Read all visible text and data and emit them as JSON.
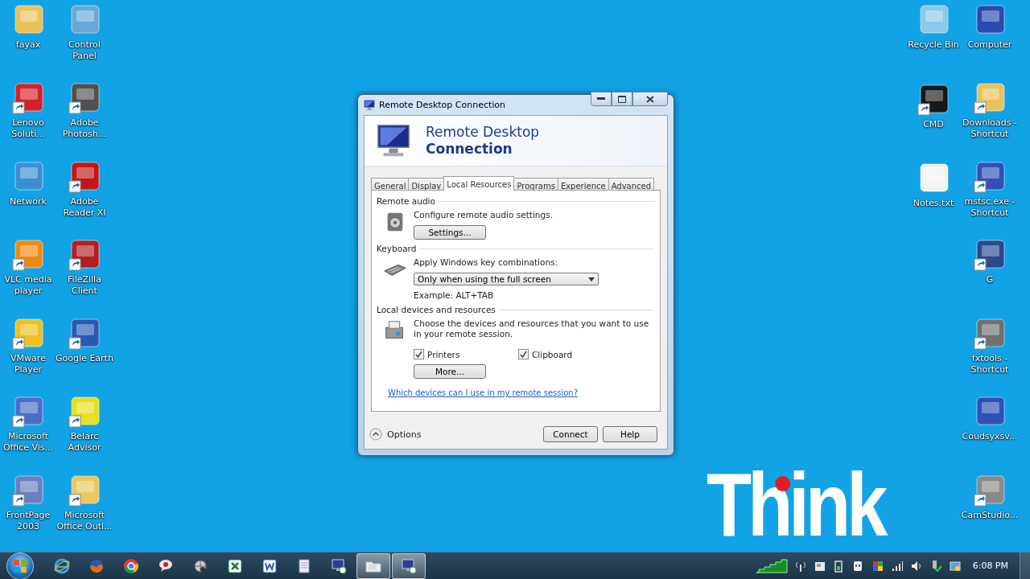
{
  "desktop": {
    "left_columns": [
      [
        {
          "label": "fayax",
          "shortcut": false,
          "color": "#e8c25a"
        },
        {
          "label": "Lenovo Soluti...",
          "shortcut": true,
          "color": "#d2232a"
        },
        {
          "label": "Network",
          "shortcut": false,
          "color": "#3a8fd0"
        },
        {
          "label": "VLC media player",
          "shortcut": true,
          "color": "#f08a10"
        },
        {
          "label": "VMware Player",
          "shortcut": true,
          "color": "#f0c020"
        },
        {
          "label": "Microsoft Office Vis...",
          "shortcut": true,
          "color": "#4a6ec8"
        },
        {
          "label": "FrontPage 2003",
          "shortcut": true,
          "color": "#6a7fc0"
        }
      ],
      [
        {
          "label": "Control Panel",
          "shortcut": false,
          "color": "#6aa8d8"
        },
        {
          "label": "Adobe Photosh...",
          "shortcut": true,
          "color": "#505050"
        },
        {
          "label": "Adobe Reader XI",
          "shortcut": true,
          "color": "#c01818"
        },
        {
          "label": "FileZilla Client",
          "shortcut": true,
          "color": "#b02020"
        },
        {
          "label": "Google Earth",
          "shortcut": true,
          "color": "#2a5ab0"
        },
        {
          "label": "Belarc Advisor",
          "shortcut": true,
          "color": "#e8e020"
        },
        {
          "label": "Microsoft Office Outl...",
          "shortcut": true,
          "color": "#e8c860"
        }
      ]
    ],
    "right_columns": [
      [
        {
          "label": "Recycle Bin",
          "shortcut": false,
          "color": "#8cc8e8"
        },
        {
          "label": "CMD",
          "shortcut": true,
          "color": "#181818"
        },
        {
          "label": "Notes.txt",
          "shortcut": false,
          "color": "#f4f4f4"
        }
      ],
      [
        {
          "label": "Computer",
          "shortcut": false,
          "color": "#2a4ab0"
        },
        {
          "label": "Downloads - Shortcut",
          "shortcut": true,
          "color": "#e8c25a"
        },
        {
          "label": "mstsc.exe - Shortcut",
          "shortcut": true,
          "color": "#3050b8"
        },
        {
          "label": "G",
          "shortcut": true,
          "color": "#2a4a8a"
        },
        {
          "label": "fxtools - Shortcut",
          "shortcut": true,
          "color": "#707070"
        },
        {
          "label": "Coudsyxsv...",
          "shortcut": false,
          "color": "#3050b8"
        },
        {
          "label": "CamStudio...",
          "shortcut": true,
          "color": "#8a8a8a"
        }
      ]
    ]
  },
  "dialog": {
    "title": "Remote Desktop Connection",
    "header": {
      "line_1": "Remote Desktop",
      "line_2": "Connection"
    },
    "tabs": [
      {
        "label": "General",
        "selected": false
      },
      {
        "label": "Display",
        "selected": false
      },
      {
        "label": "Local Resources",
        "selected": true
      },
      {
        "label": "Programs",
        "selected": false
      },
      {
        "label": "Experience",
        "selected": false
      },
      {
        "label": "Advanced",
        "selected": false
      }
    ],
    "remote_audio": {
      "heading": "Remote audio",
      "description": "Configure remote audio settings.",
      "button": "Settings..."
    },
    "keyboard": {
      "heading": "Keyboard",
      "description": "Apply Windows key combinations:",
      "dropdown": {
        "value": "Only when using the full screen"
      },
      "example": "Example: ALT+TAB"
    },
    "local_devices": {
      "heading": "Local devices and resources",
      "description": "Choose the devices and resources that you want to use in your remote session.",
      "checkboxes": [
        {
          "label": "Printers",
          "checked": true
        },
        {
          "label": "Clipboard",
          "checked": true
        }
      ],
      "button": "More..."
    },
    "link": "Which devices can I use in my remote session?",
    "options": {
      "label": "Options",
      "expanded": true
    },
    "buttons": [
      "Connect",
      "Help"
    ]
  },
  "logo": {
    "text": "Think"
  },
  "taskbar": {
    "items": [
      {
        "kind": "ie",
        "active": false
      },
      {
        "kind": "firefox",
        "active": false
      },
      {
        "kind": "chrome",
        "active": false
      },
      {
        "kind": "bubble",
        "active": false
      },
      {
        "kind": "globe",
        "active": false
      },
      {
        "kind": "excel",
        "active": false
      },
      {
        "kind": "word",
        "active": false
      },
      {
        "kind": "notepad",
        "active": false
      },
      {
        "kind": "rdc",
        "active": false
      },
      {
        "kind": "folder",
        "active": true
      },
      {
        "kind": "rdc",
        "active": true
      }
    ],
    "clock": "6:08 PM"
  }
}
